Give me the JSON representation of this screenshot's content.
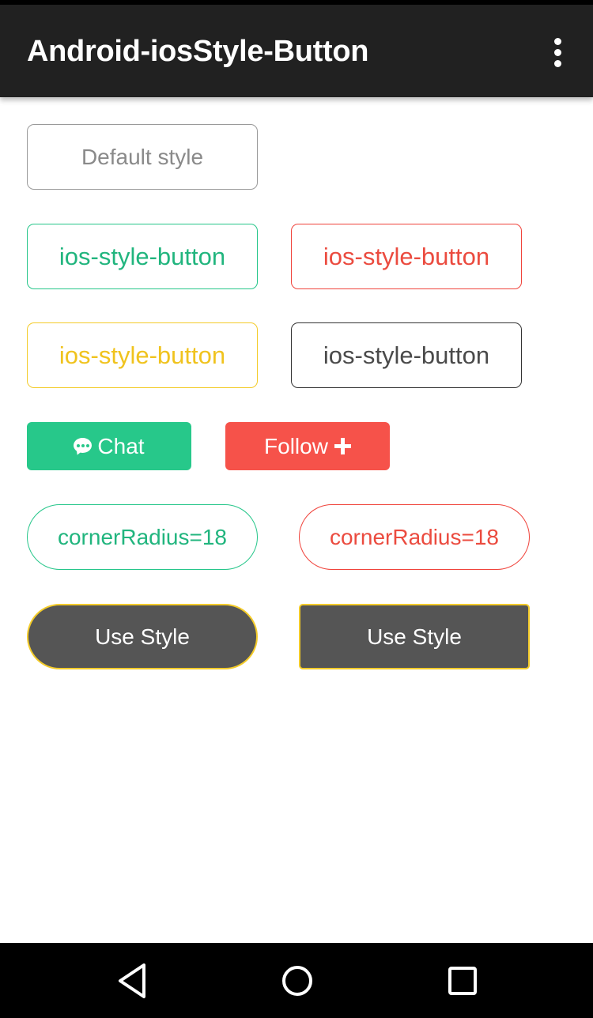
{
  "app": {
    "title": "Android-iosStyle-Button"
  },
  "toolbar": {
    "overflow_icon": "more-vert-icon"
  },
  "buttons": {
    "default": {
      "label": "Default style"
    },
    "green": {
      "label": "ios-style-button"
    },
    "red": {
      "label": "ios-style-button"
    },
    "yellow": {
      "label": "ios-style-button"
    },
    "dark": {
      "label": "ios-style-button"
    },
    "chat": {
      "label": "Chat",
      "icon": "chat-bubble-icon"
    },
    "follow": {
      "label": "Follow",
      "icon": "plus-icon"
    },
    "round_green": {
      "label": "cornerRadius=18"
    },
    "round_red": {
      "label": "cornerRadius=18"
    },
    "style_pill": {
      "label": "Use Style"
    },
    "style_rect": {
      "label": "Use Style"
    }
  },
  "navbar": {
    "back_icon": "back-triangle-icon",
    "home_icon": "home-circle-icon",
    "recents_icon": "recents-square-icon"
  },
  "colors": {
    "appbar": "#212121",
    "green": "#26c68a",
    "red": "#f0433b",
    "yellow": "#f3cb29",
    "dark": "#333333",
    "gray": "#9a9a9a",
    "follow_fill": "#f6524a",
    "style_fill": "#555555"
  }
}
